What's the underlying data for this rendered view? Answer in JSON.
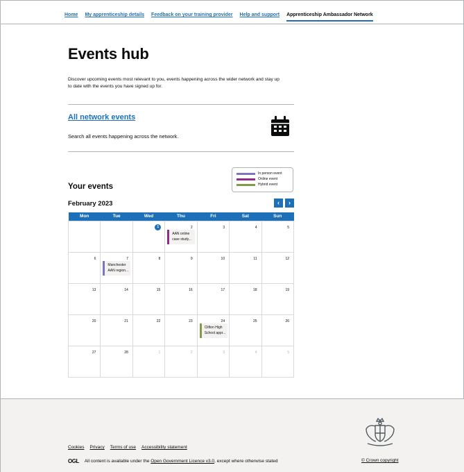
{
  "nav": {
    "items": [
      {
        "label": "Home",
        "active": false
      },
      {
        "label": "My apprenticeship details",
        "active": false
      },
      {
        "label": "Feedback on your training provider",
        "active": false
      },
      {
        "label": "Help and support",
        "active": false
      },
      {
        "label": "Apprenticeship Ambassador Network",
        "active": true
      }
    ]
  },
  "page": {
    "title": "Events hub",
    "lede": "Discover upcoming events most relevant to you, events happening across the wider network and stay up to date with the events you have signed up for."
  },
  "network": {
    "link": "All network events",
    "description": "Search all events happening across the network.",
    "icon": "calendar-icon"
  },
  "legend": {
    "items": [
      {
        "label": "In person event",
        "color": "#7a78bc"
      },
      {
        "label": "Online event",
        "color": "#912b88"
      },
      {
        "label": "Hybrid event",
        "color": "#85994b"
      }
    ]
  },
  "calendar": {
    "heading": "Your events",
    "month": "February 2023",
    "prev": "‹",
    "next": "›",
    "days": [
      "Mon",
      "Tue",
      "Wed",
      "Thu",
      "Fri",
      "Sat",
      "Sun"
    ],
    "weeks": [
      [
        "",
        "",
        "1",
        "2",
        "3",
        "4",
        "5"
      ],
      [
        "6",
        "7",
        "8",
        "9",
        "10",
        "11",
        "12"
      ],
      [
        "13",
        "14",
        "15",
        "16",
        "17",
        "18",
        "19"
      ],
      [
        "20",
        "21",
        "22",
        "23",
        "24",
        "25",
        "26"
      ],
      [
        "27",
        "28",
        "1",
        "2",
        "3",
        "4",
        "5"
      ]
    ],
    "events": {
      "e2": "AAN online case study...",
      "e7": "Manchester AAN region...",
      "e24": "Clifton High School appr..."
    }
  },
  "footer": {
    "links": [
      "Cookies",
      "Privacy",
      "Terms of use",
      "Accessibility statement"
    ],
    "ogl": "OGL",
    "licence_prefix": "All content is available under the",
    "licence_link": "Open Government Licence v3.0",
    "licence_suffix": ", except where otherwise stated",
    "copyright": "© Crown copyright"
  }
}
